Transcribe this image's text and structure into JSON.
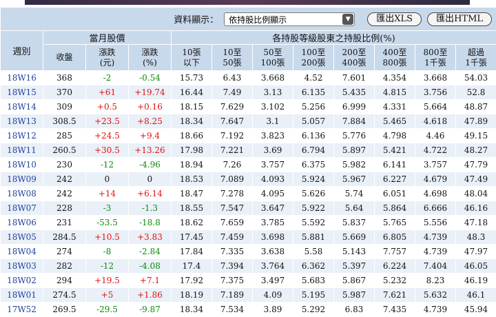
{
  "controls": {
    "display_label": "資料顯示：",
    "display_select": "依持股比例顯示",
    "export_xls": "匯出XLS",
    "export_html": "匯出HTML"
  },
  "header": {
    "week": "週別",
    "monthly_price": "當月股價",
    "holding_ratio": "各持股等級股東之持股比例(%)",
    "columns": [
      {
        "l1": "收盤",
        "l2": ""
      },
      {
        "l1": "漲跌",
        "l2": "(元)"
      },
      {
        "l1": "漲跌",
        "l2": "(%)"
      },
      {
        "l1": "10張",
        "l2": "以下"
      },
      {
        "l1": "10至",
        "l2": "50張"
      },
      {
        "l1": "50至",
        "l2": "100張"
      },
      {
        "l1": "100至",
        "l2": "200張"
      },
      {
        "l1": "200至",
        "l2": "400張"
      },
      {
        "l1": "400至",
        "l2": "800張"
      },
      {
        "l1": "800至",
        "l2": "1千張"
      },
      {
        "l1": "超過",
        "l2": "1千張"
      }
    ]
  },
  "rows": [
    [
      "18W16",
      "368",
      "-2",
      "-0.54",
      "15.73",
      "6.43",
      "3.668",
      "4.52",
      "7.601",
      "4.354",
      "3.668",
      "54.03"
    ],
    [
      "18W15",
      "370",
      "+61",
      "+19.74",
      "16.44",
      "7.49",
      "3.13",
      "6.135",
      "5.435",
      "4.815",
      "3.756",
      "52.8"
    ],
    [
      "18W14",
      "309",
      "+0.5",
      "+0.16",
      "18.15",
      "7.629",
      "3.102",
      "5.256",
      "6.999",
      "4.331",
      "5.664",
      "48.87"
    ],
    [
      "18W13",
      "308.5",
      "+23.5",
      "+8.25",
      "18.34",
      "7.647",
      "3.1",
      "5.057",
      "7.884",
      "5.465",
      "4.618",
      "47.89"
    ],
    [
      "18W12",
      "285",
      "+24.5",
      "+9.4",
      "18.66",
      "7.192",
      "3.823",
      "6.136",
      "5.776",
      "4.798",
      "4.46",
      "49.15"
    ],
    [
      "18W11",
      "260.5",
      "+30.5",
      "+13.26",
      "17.98",
      "7.221",
      "3.69",
      "6.794",
      "5.897",
      "5.421",
      "4.722",
      "48.27"
    ],
    [
      "18W10",
      "230",
      "-12",
      "-4.96",
      "18.94",
      "7.26",
      "3.757",
      "6.375",
      "5.982",
      "6.141",
      "3.757",
      "47.79"
    ],
    [
      "18W09",
      "242",
      "0",
      "0",
      "18.53",
      "7.089",
      "4.093",
      "5.924",
      "5.967",
      "6.227",
      "4.679",
      "47.49"
    ],
    [
      "18W08",
      "242",
      "+14",
      "+6.14",
      "18.47",
      "7.278",
      "4.095",
      "5.626",
      "5.74",
      "6.051",
      "4.698",
      "48.04"
    ],
    [
      "18W07",
      "228",
      "-3",
      "-1.3",
      "18.55",
      "7.547",
      "3.647",
      "5.922",
      "5.64",
      "5.864",
      "6.666",
      "46.16"
    ],
    [
      "18W06",
      "231",
      "-53.5",
      "-18.8",
      "18.62",
      "7.659",
      "3.785",
      "5.592",
      "5.837",
      "5.765",
      "5.556",
      "47.18"
    ],
    [
      "18W05",
      "284.5",
      "+10.5",
      "+3.83",
      "17.45",
      "7.459",
      "3.698",
      "5.881",
      "5.669",
      "6.805",
      "4.739",
      "48.3"
    ],
    [
      "18W04",
      "274",
      "-8",
      "-2.84",
      "17.84",
      "7.335",
      "3.638",
      "5.58",
      "5.143",
      "7.757",
      "4.739",
      "47.97"
    ],
    [
      "18W03",
      "282",
      "-12",
      "-4.08",
      "17.4",
      "7.394",
      "3.764",
      "6.362",
      "5.397",
      "6.224",
      "7.404",
      "46.05"
    ],
    [
      "18W02",
      "294",
      "+19.5",
      "+7.1",
      "17.92",
      "7.375",
      "3.497",
      "5.683",
      "5.867",
      "5.232",
      "8.23",
      "46.19"
    ],
    [
      "18W01",
      "274.5",
      "+5",
      "+1.86",
      "18.19",
      "7.189",
      "4.09",
      "5.195",
      "5.987",
      "7.621",
      "5.632",
      "46.1"
    ],
    [
      "17W52",
      "269.5",
      "-29.5",
      "-9.87",
      "18.34",
      "7.534",
      "3.89",
      "5.292",
      "6.83",
      "7.435",
      "4.739",
      "45.94"
    ]
  ],
  "colors": {
    "header_bg": "#c9d9ec",
    "row_alt": "#eaf0f8",
    "up": "#e01010",
    "down": "#0a8a0a",
    "week": "#1f3f9a"
  }
}
